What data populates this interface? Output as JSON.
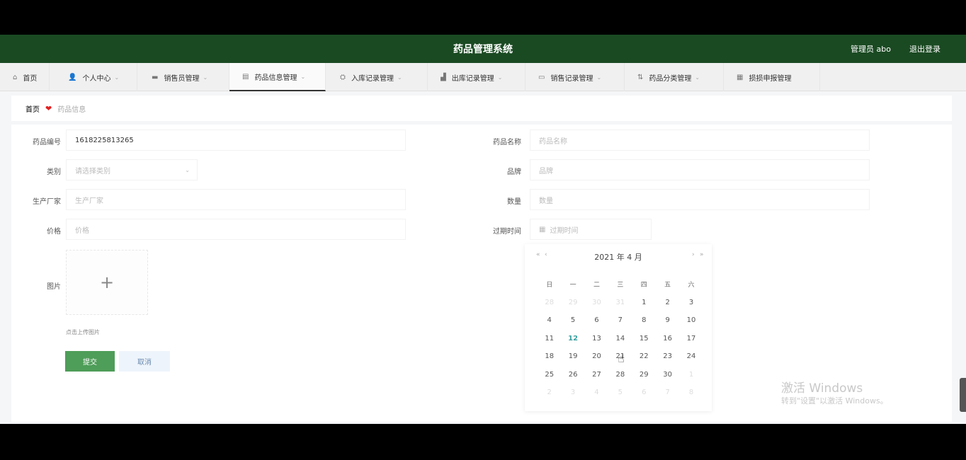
{
  "header": {
    "title": "药品管理系统",
    "user": "管理员 abo",
    "logout": "退出登录"
  },
  "nav": [
    {
      "label": "首页",
      "icon": "home-icon",
      "glyph": "⌂",
      "has_dropdown": false
    },
    {
      "label": "个人中心",
      "icon": "user-icon",
      "glyph": "👤",
      "has_dropdown": true
    },
    {
      "label": "销售员管理",
      "icon": "monitor-icon",
      "glyph": "▬",
      "has_dropdown": true
    },
    {
      "label": "药品信息管理",
      "icon": "document-icon",
      "glyph": "▤",
      "has_dropdown": true
    },
    {
      "label": "入库记录管理",
      "icon": "users-icon",
      "glyph": "⛭",
      "has_dropdown": true
    },
    {
      "label": "出库记录管理",
      "icon": "chart-icon",
      "glyph": "▟",
      "has_dropdown": true
    },
    {
      "label": "销售记录管理",
      "icon": "table-icon",
      "glyph": "▭",
      "has_dropdown": true
    },
    {
      "label": "药品分类管理",
      "icon": "sort-icon",
      "glyph": "⇅",
      "has_dropdown": true
    },
    {
      "label": "损损申报管理",
      "icon": "list-icon",
      "glyph": "▦",
      "has_dropdown": false
    }
  ],
  "breadcrumb": {
    "home": "首页",
    "current": "药品信息"
  },
  "form": {
    "drug_no": {
      "label": "药品编号",
      "value": "1618225813265"
    },
    "drug_name": {
      "label": "药品名称",
      "placeholder": "药品名称"
    },
    "category": {
      "label": "类别",
      "placeholder": "请选择类别"
    },
    "brand": {
      "label": "品牌",
      "placeholder": "品牌"
    },
    "manufacturer": {
      "label": "生产厂家",
      "placeholder": "生产厂家"
    },
    "quantity": {
      "label": "数量",
      "placeholder": "数量"
    },
    "price": {
      "label": "价格",
      "placeholder": "价格"
    },
    "expiry": {
      "label": "过期时间",
      "placeholder": "过期时间"
    },
    "image": {
      "label": "图片",
      "tip": "点击上传图片"
    },
    "submit": "提交",
    "cancel": "取消"
  },
  "calendar": {
    "year": "2021",
    "year_unit": "年",
    "month": "4",
    "month_unit": "月",
    "prev_year": "«",
    "prev_month": "‹",
    "next_month": "›",
    "next_year": "»",
    "weekdays": [
      "日",
      "一",
      "二",
      "三",
      "四",
      "五",
      "六"
    ],
    "weeks": [
      [
        "28",
        "29",
        "30",
        "31",
        "1",
        "2",
        "3"
      ],
      [
        "4",
        "5",
        "6",
        "7",
        "8",
        "9",
        "10"
      ],
      [
        "11",
        "12",
        "13",
        "14",
        "15",
        "16",
        "17"
      ],
      [
        "18",
        "19",
        "20",
        "21",
        "22",
        "23",
        "24"
      ],
      [
        "25",
        "26",
        "27",
        "28",
        "29",
        "30",
        "1"
      ],
      [
        "2",
        "3",
        "4",
        "5",
        "6",
        "7",
        "8"
      ]
    ],
    "today": "12"
  },
  "watermark": {
    "line1": "激活 Windows",
    "line2": "转到\"设置\"以激活 Windows。"
  }
}
